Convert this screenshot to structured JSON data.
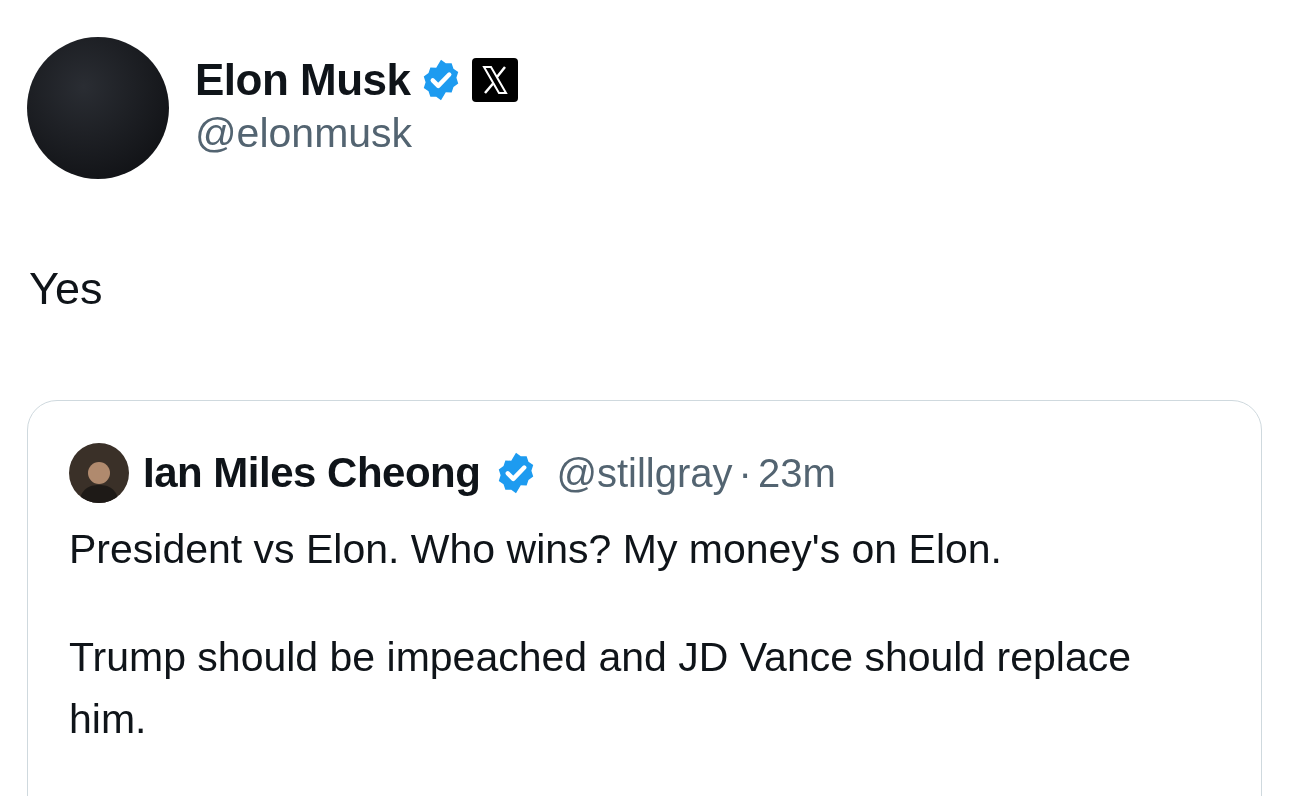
{
  "author": {
    "name": "Elon Musk",
    "handle": "@elonmusk",
    "verified": true,
    "affiliate": true
  },
  "text": "Yes",
  "quote": {
    "author": {
      "name": "Ian Miles Cheong",
      "handle": "@stillgray",
      "verified": true
    },
    "separator": "·",
    "time": "23m",
    "paragraphs": [
      "President vs Elon. Who wins? My money's on Elon.",
      "Trump should be impeached and JD Vance should replace him."
    ]
  }
}
